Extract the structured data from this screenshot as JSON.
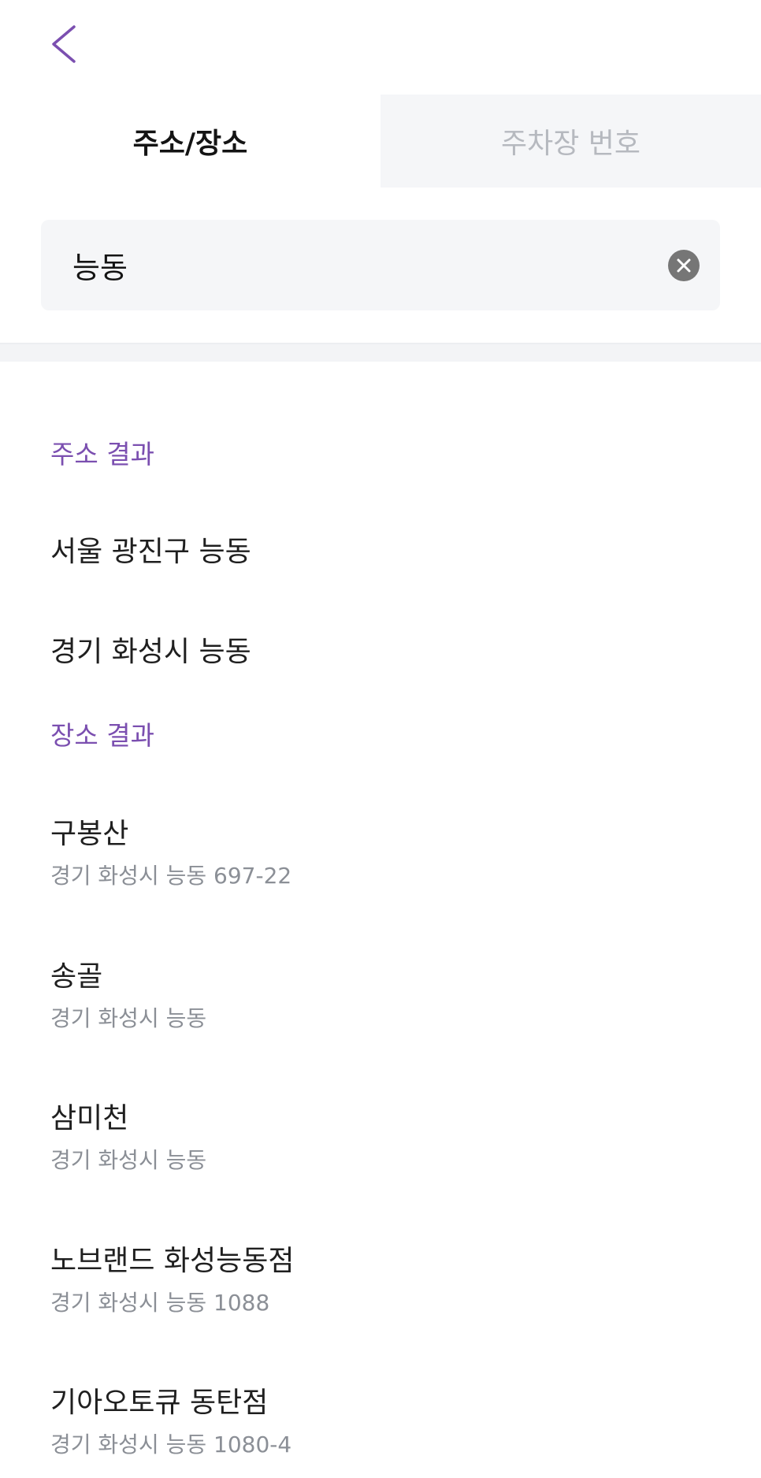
{
  "header": {
    "back_icon": "chevron-left-icon",
    "accent_color": "#7b4fb0"
  },
  "tabs": [
    {
      "label": "주소/장소",
      "active": true
    },
    {
      "label": "주차장 번호",
      "active": false
    }
  ],
  "search": {
    "value": "능동",
    "clear_icon": "clear-circle-icon"
  },
  "address_results": {
    "header": "주소 결과",
    "items": [
      {
        "label": "서울 광진구 능동"
      },
      {
        "label": "경기 화성시 능동"
      }
    ]
  },
  "place_results": {
    "header": "장소 결과",
    "items": [
      {
        "name": "구봉산",
        "address": "경기 화성시 능동 697-22"
      },
      {
        "name": "송골",
        "address": "경기 화성시 능동"
      },
      {
        "name": "삼미천",
        "address": "경기 화성시 능동"
      },
      {
        "name": "노브랜드 화성능동점",
        "address": "경기 화성시 능동 1088"
      },
      {
        "name": "기아오토큐 동탄점",
        "address": "경기 화성시 능동 1080-4"
      }
    ]
  }
}
